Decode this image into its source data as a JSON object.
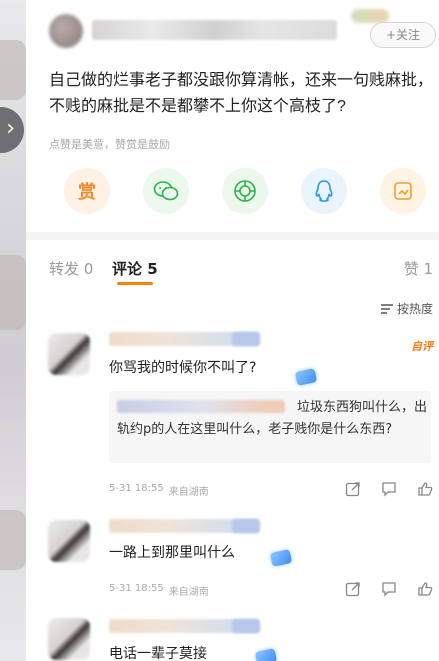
{
  "header": {
    "follow_label": "+关注"
  },
  "post": {
    "text": "自己做的烂事老子都没跟你算清帐，还来一句贱麻批，不贱的麻批是不是都攀不上你这个高枝了?",
    "reward_note": "点赞是美意，赞赏是鼓励",
    "reward_glyph": "赏"
  },
  "tabs": {
    "repost": "转发 0",
    "comments": "评论 5",
    "likes": "赞 1",
    "sort": "按热度"
  },
  "comments": [
    {
      "text": "你骂我的时候你不叫了?",
      "author_tag": "自评",
      "reply": "垃圾东西狗叫什么，出轨约p的人在这里叫什么，老子贱你是什么东西?",
      "date": "5-31 18:55",
      "location": "来自湖南"
    },
    {
      "text": "一路上到那里叫什么",
      "date": "5-31 18:55",
      "location": "来自湖南"
    },
    {
      "text": "电话一辈子莫接"
    }
  ],
  "colors": {
    "accent": "#ff8200",
    "author_tag": "#ff7a1a"
  }
}
